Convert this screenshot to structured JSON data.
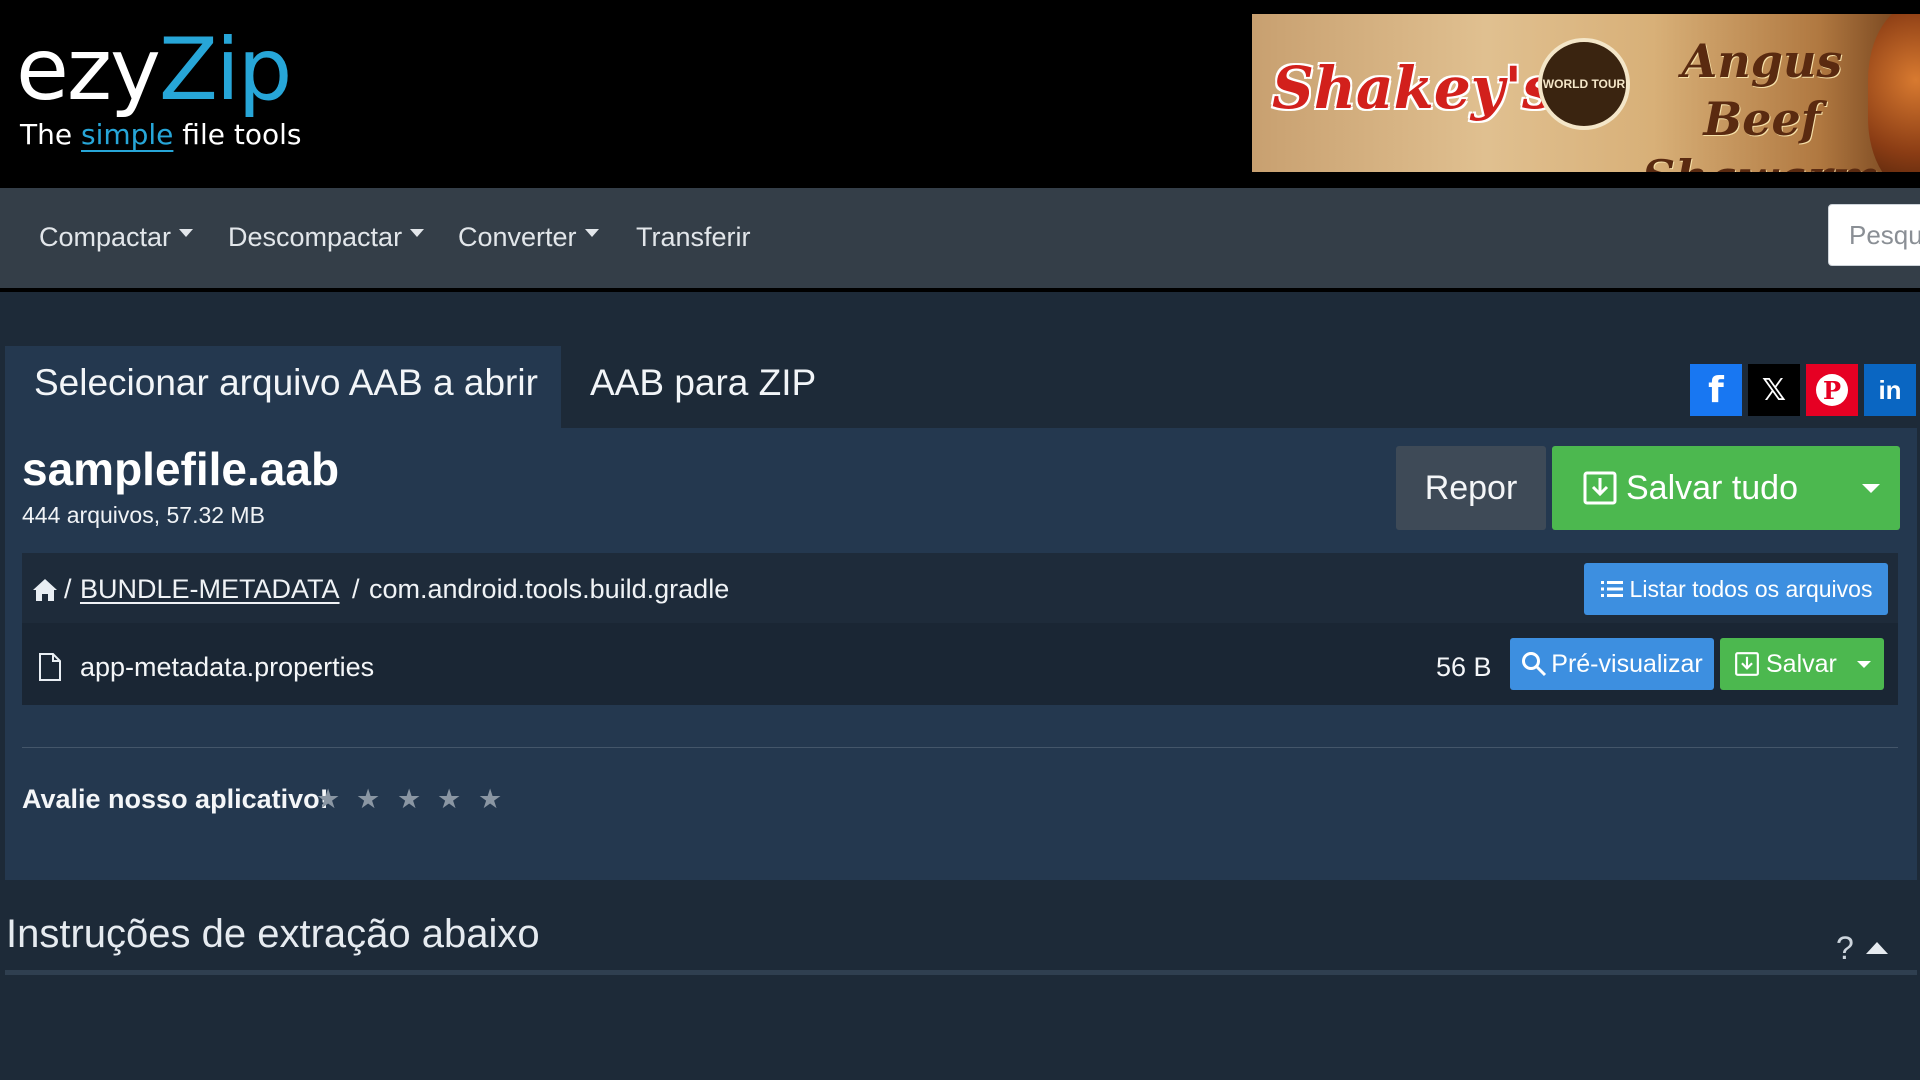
{
  "logo": {
    "ezy": "ezy",
    "zip": "Zip",
    "tag_the": "The ",
    "tag_simple": "simple",
    "tag_rest": " file tools"
  },
  "ad": {
    "brand": "Shakey's",
    "seal": "WORLD TOUR",
    "product": "Angus Beef Shawarma"
  },
  "nav": {
    "items": [
      {
        "label": "Compactar",
        "dropdown": true
      },
      {
        "label": "Descompactar",
        "dropdown": true
      },
      {
        "label": "Converter",
        "dropdown": true
      },
      {
        "label": "Transferir",
        "dropdown": false
      }
    ],
    "search_placeholder": "Pesquisar"
  },
  "tabs": {
    "active": "Selecionar arquivo AAB a abrir",
    "inactive": "AAB para ZIP"
  },
  "share": {
    "facebook": "f",
    "x": "𝕏",
    "pinterest": "P",
    "linkedin": "in"
  },
  "file": {
    "name": "samplefile.aab",
    "meta": "444 arquivos, 57.32 MB"
  },
  "actions": {
    "reset": "Repor",
    "save_all": "Salvar tudo",
    "list_all": "Listar todos os arquivos"
  },
  "breadcrumb": {
    "sep1": "/",
    "link": "BUNDLE-METADATA",
    "sep2": "/",
    "current": "com.android.tools.build.gradle"
  },
  "files": [
    {
      "name": "app-metadata.properties",
      "size": "56 B",
      "preview": "Pré-visualizar",
      "save": "Salvar"
    }
  ],
  "rating": {
    "label": "Avalie nosso aplicativo!",
    "stars": [
      "★",
      "★",
      "★",
      "★",
      "★"
    ],
    "value": 0,
    "max": 5
  },
  "instructions": {
    "title": "Instruções de extração abaixo",
    "help": "?"
  },
  "colors": {
    "accent_blue": "#27a6d8",
    "save_green": "#4cb84f",
    "button_blue": "#3d8fe0",
    "panel": "#24384f"
  }
}
